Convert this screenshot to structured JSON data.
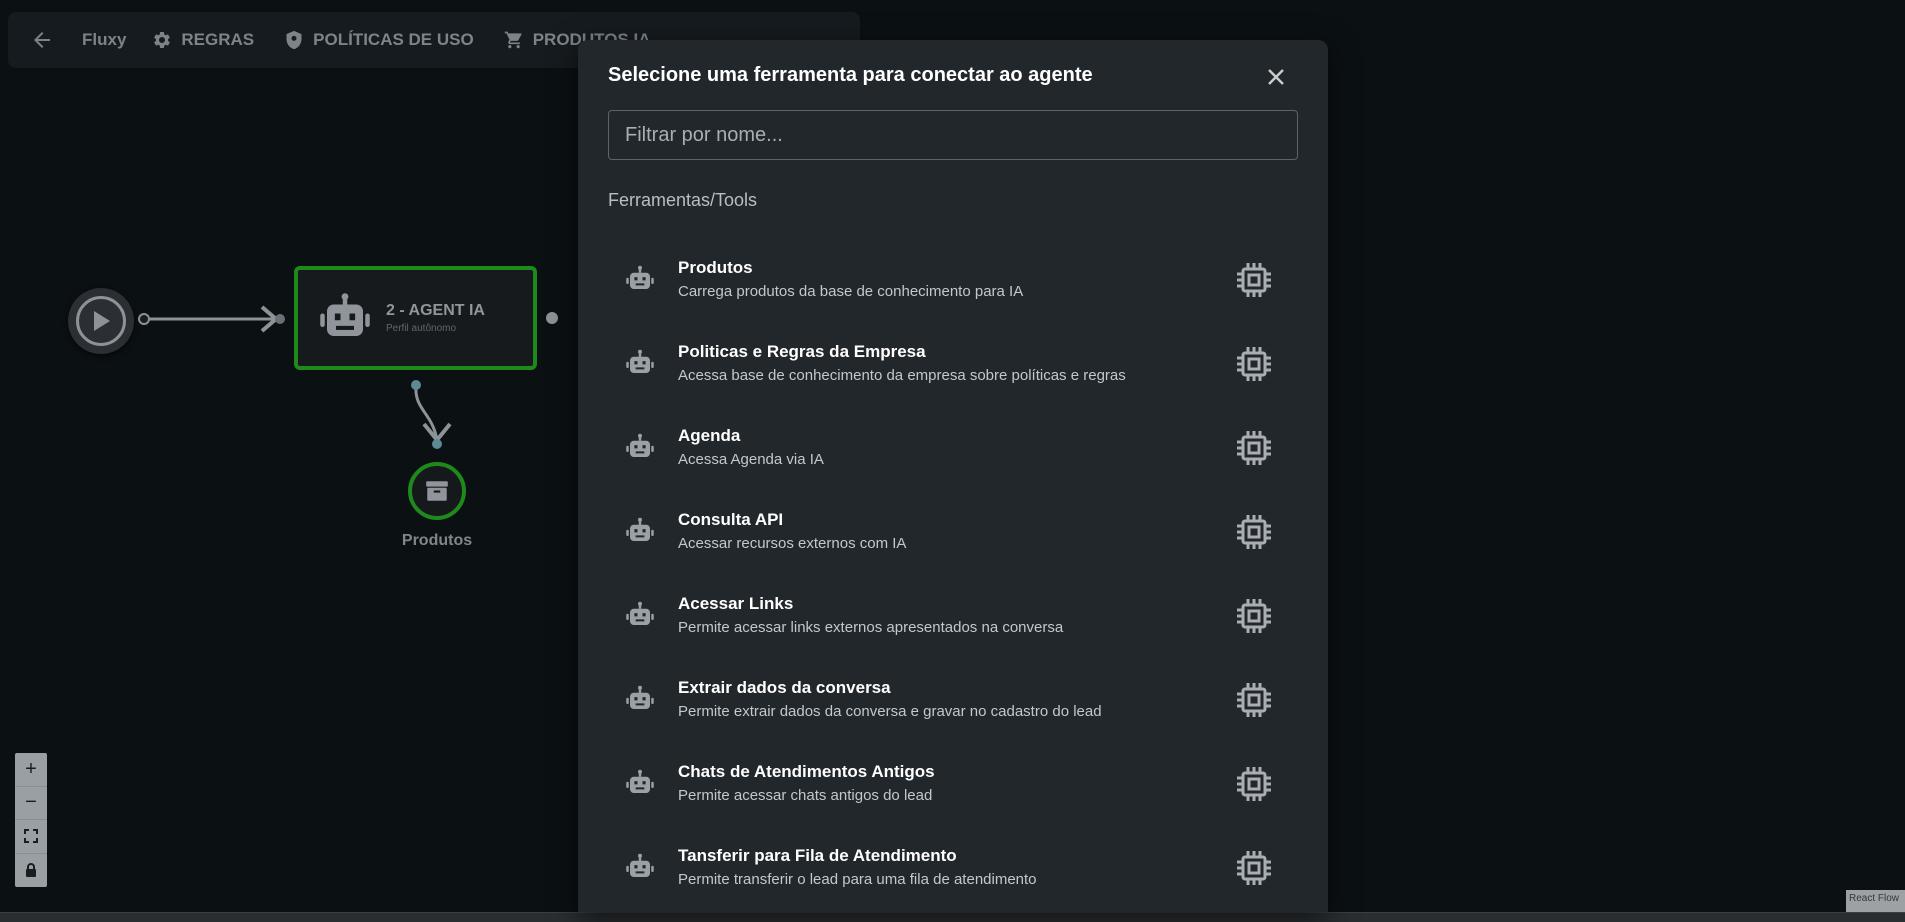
{
  "toolbar": {
    "brand": "Fluxy",
    "items": [
      {
        "label": "REGRAS",
        "icon": "gear-icon"
      },
      {
        "label": "POLÍTICAS DE USO",
        "icon": "shield-icon"
      },
      {
        "label": "PRODUTOS IA",
        "icon": "cart-icon"
      }
    ]
  },
  "flow": {
    "agent_node": {
      "title": "2 - AGENT IA",
      "subtitle": "Perfil autônomo"
    },
    "tool_node": {
      "label": "Produtos"
    }
  },
  "controls": {
    "zoom_in": "+",
    "zoom_out": "−"
  },
  "attribution": {
    "text": "React Flow"
  },
  "modal": {
    "title": "Selecione uma ferramenta para conectar ao agente",
    "search": {
      "placeholder": "Filtrar por nome...",
      "value": ""
    },
    "section_label": "Ferramentas/Tools",
    "tools": [
      {
        "name": "Produtos",
        "description": "Carrega produtos da base de conhecimento para IA"
      },
      {
        "name": "Politicas e Regras da Empresa",
        "description": "Acessa base de conhecimento da empresa sobre políticas e regras"
      },
      {
        "name": "Agenda",
        "description": "Acessa Agenda via IA"
      },
      {
        "name": "Consulta API",
        "description": "Acessar recursos externos com IA"
      },
      {
        "name": "Acessar Links",
        "description": "Permite acessar links externos apresentados na conversa"
      },
      {
        "name": "Extrair dados da conversa",
        "description": "Permite extrair dados da conversa e gravar no cadastro do lead"
      },
      {
        "name": "Chats de Atendimentos Antigos",
        "description": "Permite acessar chats antigos do lead"
      },
      {
        "name": "Tansferir para Fila de Atendimento",
        "description": "Permite transferir o lead para uma fila de atendimento"
      }
    ]
  },
  "colors": {
    "canvas_bg": "#0b1013",
    "modal_bg": "#22272b",
    "node_border_green": "#1f8a1c",
    "icon_gray": "#9aa0a5"
  }
}
